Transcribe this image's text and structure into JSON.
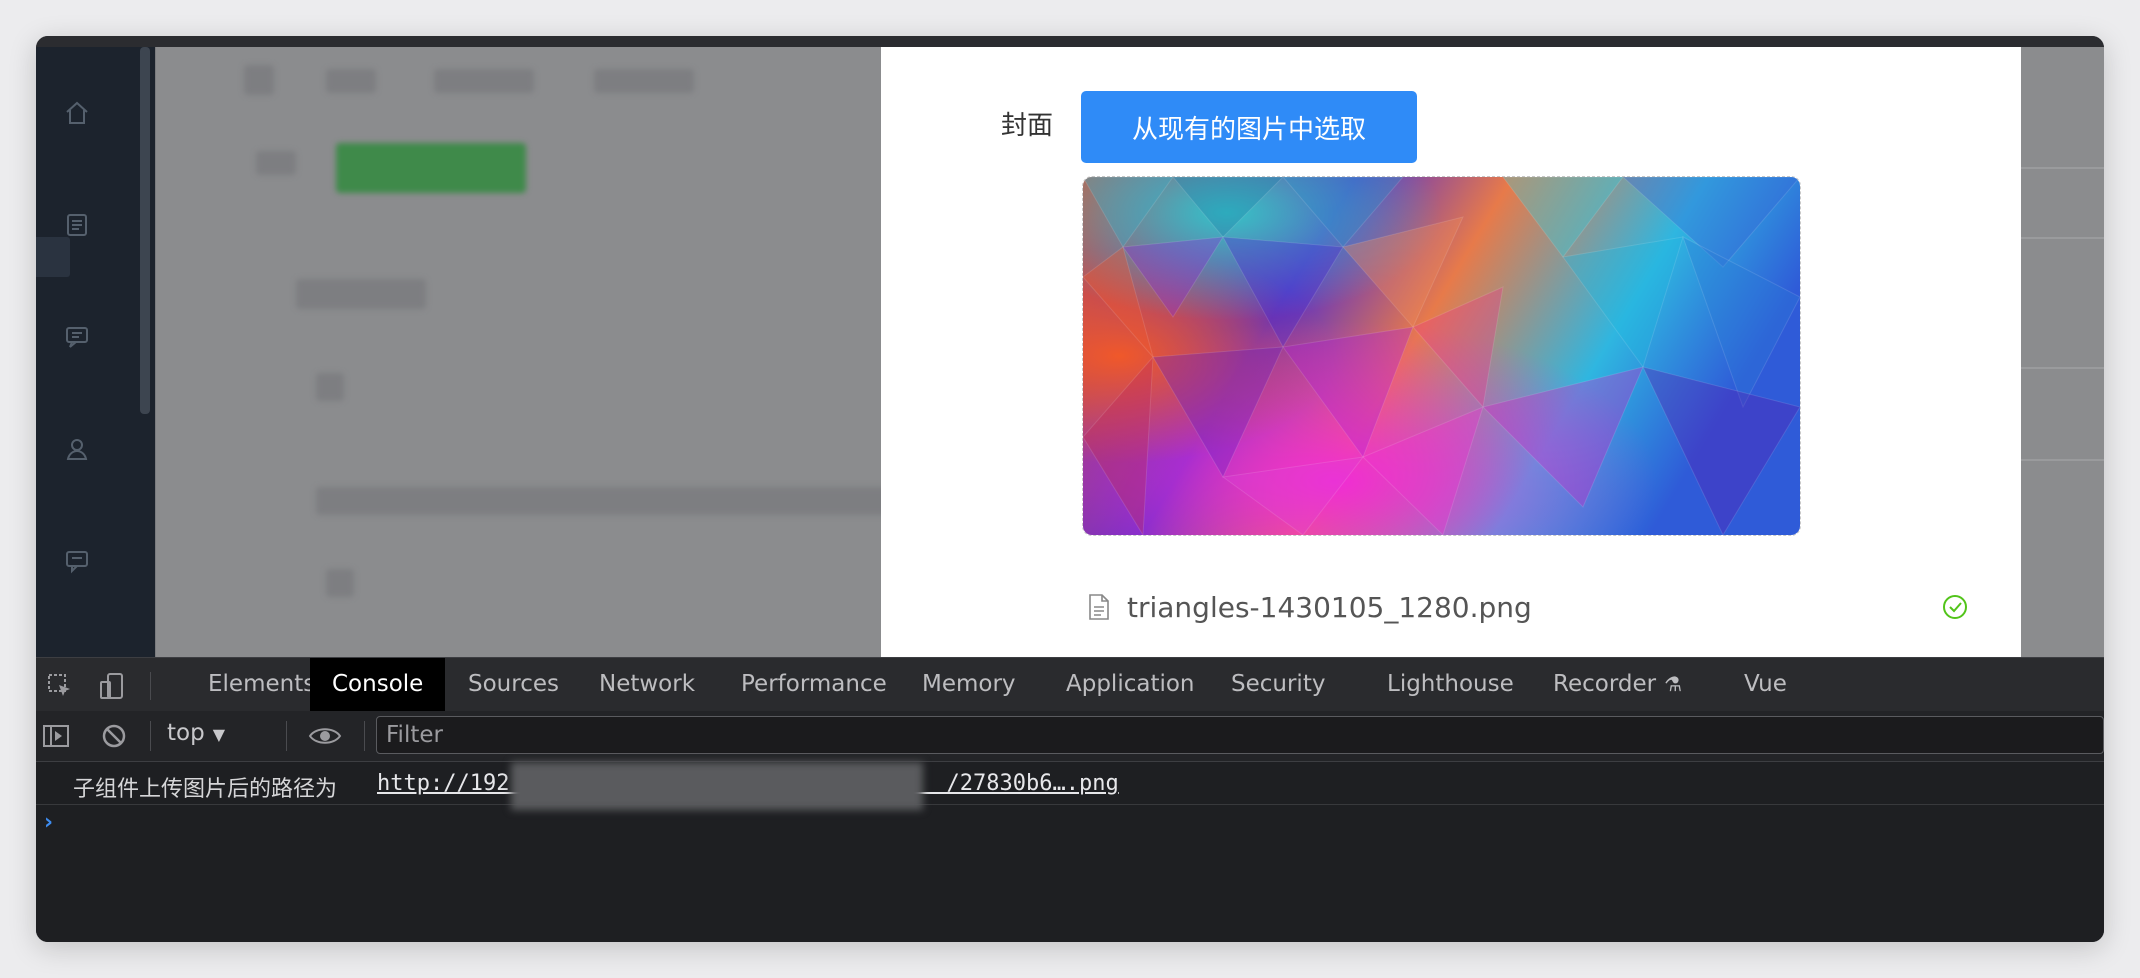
{
  "modal": {
    "cover_label": "封面",
    "pick_button_label": "从现有的图片中选取",
    "file_name": "triangles-1430105_1280.png"
  },
  "sidebar": {
    "icons": [
      "home-icon",
      "document-icon",
      "chat-icon",
      "user-icon",
      "comment-icon"
    ]
  },
  "devtools": {
    "tabs": [
      {
        "label": "Elements"
      },
      {
        "label": "Console"
      },
      {
        "label": "Sources"
      },
      {
        "label": "Network"
      },
      {
        "label": "Performance"
      },
      {
        "label": "Memory"
      },
      {
        "label": "Application"
      },
      {
        "label": "Security"
      },
      {
        "label": "Lighthouse"
      },
      {
        "label": "Recorder"
      },
      {
        "label": "Vue"
      }
    ],
    "active_tab": "Console",
    "context": "top",
    "filter_placeholder": "Filter",
    "console": {
      "log_text": "子组件上传图片后的路径为",
      "log_link": "http://192                                 /27830b6….png"
    }
  },
  "colors": {
    "primary_button": "#2f8bf7",
    "success_icon": "#52c41a",
    "prompt_caret": "#3e8cf0"
  }
}
